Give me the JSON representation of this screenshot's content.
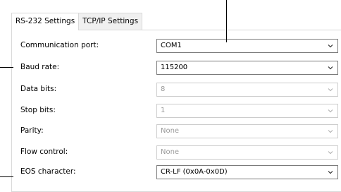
{
  "tabs": [
    {
      "label": "RS-232 Settings",
      "active": true
    },
    {
      "label": "TCP/IP Settings",
      "active": false
    }
  ],
  "settings": [
    {
      "label": "Communication port:",
      "value": "COM1",
      "enabled": true
    },
    {
      "label": "Baud rate:",
      "value": "115200",
      "enabled": true
    },
    {
      "label": "Data bits:",
      "value": "8",
      "enabled": false
    },
    {
      "label": "Stop bits:",
      "value": "1",
      "enabled": false
    },
    {
      "label": "Parity:",
      "value": "None",
      "enabled": false
    },
    {
      "label": "Flow control:",
      "value": "None",
      "enabled": false
    },
    {
      "label": "EOS character:",
      "value": "CR-LF (0x0A-0x0D)",
      "enabled": true
    }
  ],
  "icons": {
    "dropdown": "chevron-down-icon"
  },
  "colors": {
    "enabled_border": "#7a7a7a",
    "disabled_border": "#cccccc",
    "disabled_text": "#9a9a9a"
  }
}
